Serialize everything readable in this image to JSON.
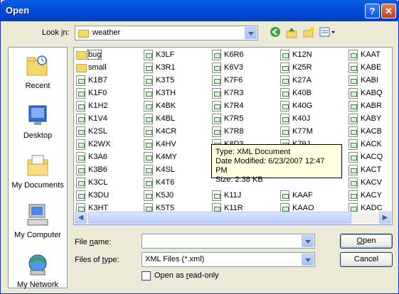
{
  "window": {
    "title": "Open"
  },
  "title_buttons": {
    "help": "?",
    "close": "✕"
  },
  "lookin": {
    "label_pre": "Look ",
    "label_ul": "i",
    "label_post": "n:",
    "value": "weather"
  },
  "toolbar": {
    "icons": [
      "back-icon",
      "up-folder-icon",
      "new-folder-icon",
      "views-menu-icon"
    ]
  },
  "places": [
    {
      "label": "Recent",
      "icon": "recent-icon"
    },
    {
      "label": "Desktop",
      "icon": "desktop-icon"
    },
    {
      "label": "My Documents",
      "icon": "my-documents-icon"
    },
    {
      "label": "My Computer",
      "icon": "my-computer-icon"
    },
    {
      "label": "My Network",
      "icon": "my-network-icon"
    }
  ],
  "files": {
    "col1": [
      "bug",
      "small",
      "K1B7",
      "K1F0",
      "K1H2",
      "K1V4",
      "K2SL",
      "K2WX",
      "K3A6",
      "K3B6",
      "K3CL",
      "K3DU",
      "K3HT"
    ],
    "col2": [
      "K3LF",
      "K3R1",
      "K3T5",
      "K3TH",
      "K4BK",
      "K4BL",
      "K4CR",
      "K4HV",
      "K4MY",
      "K4SL",
      "K4T6",
      "K5J0",
      "K5T5"
    ],
    "col3": [
      "K6R6",
      "K6V3",
      "K7F6",
      "K7R3",
      "K7R4",
      "K7R5",
      "K7R8",
      "K8D3",
      "",
      "",
      "",
      "K11J",
      "K11R"
    ],
    "col4": [
      "K12N",
      "K25R",
      "K27A",
      "K40B",
      "K40G",
      "K40J",
      "K77M",
      "K79J",
      "",
      "",
      "",
      "KAAF",
      "KAAO"
    ],
    "col5": [
      "KAAT",
      "KABE",
      "KABI",
      "KABQ",
      "KABR",
      "KABY",
      "KACB",
      "KACK",
      "KACQ",
      "KACT",
      "KACV",
      "KACY",
      "KADC"
    ]
  },
  "tooltip": {
    "type": "Type: XML Document",
    "modified": "Date Modified: 6/23/2007 12:47 PM",
    "size": "Size: 2.38 KB"
  },
  "filename": {
    "label_pre": "File ",
    "label_ul": "n",
    "label_post": "ame:",
    "value": ""
  },
  "filetype": {
    "label_pre": "Files of ",
    "label_ul": "t",
    "label_post": "ype:",
    "value": "XML Files (*.xml)"
  },
  "readonly": {
    "label_pre": "Open as ",
    "label_ul": "r",
    "label_post": "ead-only",
    "checked": false
  },
  "buttons": {
    "open_ul": "O",
    "open_rest": "pen",
    "cancel": "Cancel"
  },
  "colors": {
    "title_blue": "#0046d5",
    "face": "#ece9d8"
  }
}
